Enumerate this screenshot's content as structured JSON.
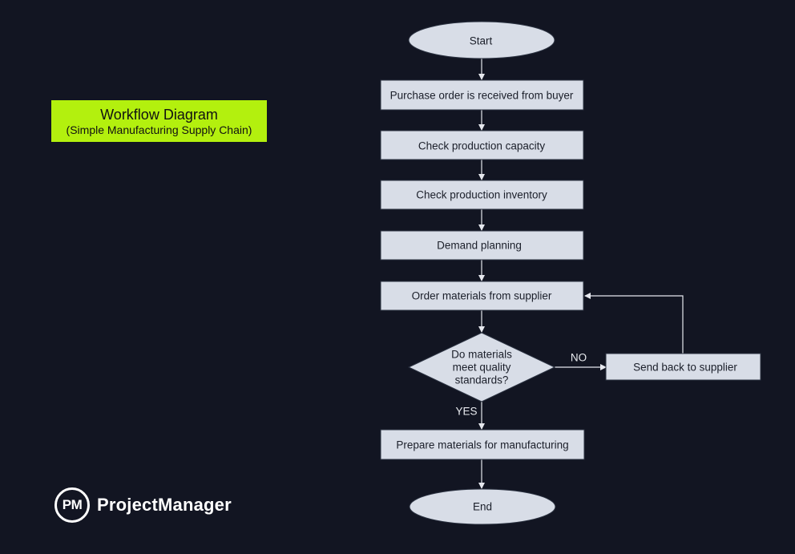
{
  "title": {
    "main": "Workflow Diagram",
    "subtitle": "(Simple Manufacturing Supply Chain)",
    "background_color": "#b3f00e"
  },
  "brand": {
    "logo_initials": "PM",
    "name": "ProjectManager"
  },
  "colors": {
    "background": "#121522",
    "node_fill": "#d8dde7",
    "connector": "#e6e8ee"
  },
  "flow": {
    "nodes": [
      {
        "id": "start",
        "shape": "ellipse",
        "text": "Start"
      },
      {
        "id": "purchase-order",
        "shape": "rect",
        "text": "Purchase order is received from buyer"
      },
      {
        "id": "check-capacity",
        "shape": "rect",
        "text": "Check production capacity"
      },
      {
        "id": "check-inventory",
        "shape": "rect",
        "text": "Check production inventory"
      },
      {
        "id": "demand-planning",
        "shape": "rect",
        "text": "Demand planning"
      },
      {
        "id": "order-materials",
        "shape": "rect",
        "text": "Order materials from supplier"
      },
      {
        "id": "quality-check",
        "shape": "diamond",
        "text": [
          "Do materials",
          "meet quality",
          "standards?"
        ]
      },
      {
        "id": "send-back",
        "shape": "rect",
        "text": "Send back to supplier"
      },
      {
        "id": "prepare-materials",
        "shape": "rect",
        "text": "Prepare materials for manufacturing"
      },
      {
        "id": "end",
        "shape": "ellipse",
        "text": "End"
      }
    ],
    "edges": [
      {
        "from": "start",
        "to": "purchase-order"
      },
      {
        "from": "purchase-order",
        "to": "check-capacity"
      },
      {
        "from": "check-capacity",
        "to": "check-inventory"
      },
      {
        "from": "check-inventory",
        "to": "demand-planning"
      },
      {
        "from": "demand-planning",
        "to": "order-materials"
      },
      {
        "from": "order-materials",
        "to": "quality-check"
      },
      {
        "from": "quality-check",
        "to": "send-back",
        "label": "NO"
      },
      {
        "from": "send-back",
        "to": "order-materials"
      },
      {
        "from": "quality-check",
        "to": "prepare-materials",
        "label": "YES"
      },
      {
        "from": "prepare-materials",
        "to": "end"
      }
    ]
  }
}
